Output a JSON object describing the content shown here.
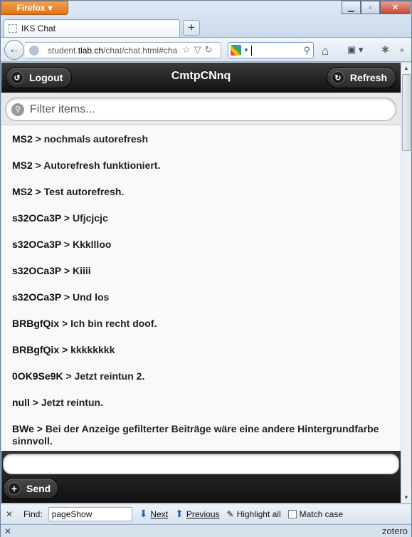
{
  "browser": {
    "menu_label": "Firefox",
    "tab_title": "IKS Chat",
    "url_prefix": "student.",
    "url_domain": "tlab.ch",
    "url_path": "/chat/chat.html#cha"
  },
  "app": {
    "title": "CmtpCNnq",
    "logout_label": "Logout",
    "refresh_label": "Refresh",
    "filter_placeholder": "Filter items...",
    "send_label": "Send",
    "message_placeholder": ""
  },
  "messages": [
    {
      "nick": "MS2",
      "text": " > nochmals autorefresh"
    },
    {
      "nick": "MS2",
      "text": " > Autorefresh funktioniert."
    },
    {
      "nick": "MS2",
      "text": " > Test autorefresh."
    },
    {
      "nick": "s32OCa3P",
      "text": " > Ufjcjcjc"
    },
    {
      "nick": "s32OCa3P",
      "text": " > Kkklllo‌o"
    },
    {
      "nick": "s32OCa3P",
      "text": " > Kiiii"
    },
    {
      "nick": "s32OCa3P",
      "text": " > Und los"
    },
    {
      "nick": "BRBgfQix",
      "text": " > Ich bin recht doof."
    },
    {
      "nick": "BRBgfQix",
      "text": " > kkkkkkkk"
    },
    {
      "nick": "0OK9Se9K",
      "text": " > Jetzt reintun 2."
    },
    {
      "nick": "null",
      "text": " > Jetzt reintun."
    },
    {
      "nick": "BWe",
      "text": " > Bei der Anzeige gefilterter Beiträge wäre eine andere Hintergrundfarbe sinnvoll."
    }
  ],
  "findbar": {
    "find_label": "Find:",
    "query": "pageShow",
    "next_label": "Next",
    "previous_label": "Previous",
    "highlight_label": "Highlight all",
    "match_case_label": "Match case"
  },
  "status": {
    "zotero": "zotero"
  }
}
